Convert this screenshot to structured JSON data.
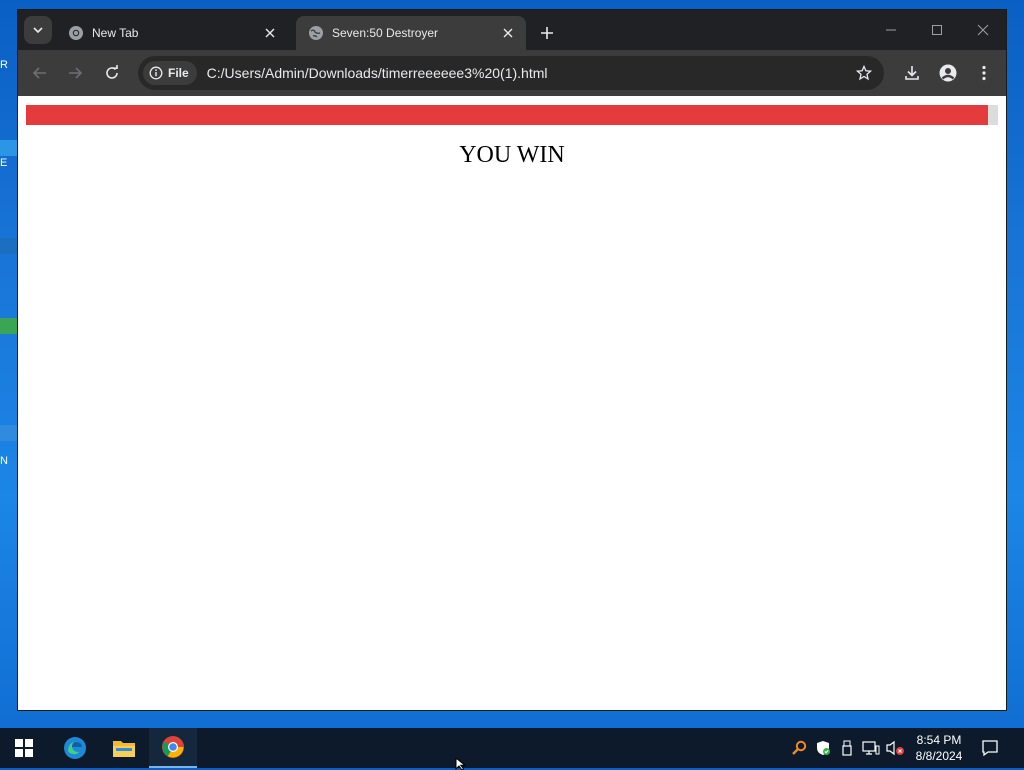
{
  "desktop": {
    "edge_glyphs": [
      "R",
      "E",
      "N"
    ]
  },
  "browser": {
    "tabs": [
      {
        "title": "New Tab",
        "active": false,
        "favicon": "chrome-icon"
      },
      {
        "title": "Seven:50 Destroyer",
        "active": true,
        "favicon": "globe-icon"
      }
    ],
    "address_bar": {
      "chip_label": "File",
      "url": "C:/Users/Admin/Downloads/timerreeeeee3%20(1).html"
    },
    "colors": {
      "tabbar_bg": "#202124",
      "toolbar_bg": "#3c3c3c",
      "omnibox_bg": "#282828"
    }
  },
  "page": {
    "progress_fraction": 0.99,
    "progress_color": "#e43c3c",
    "progress_track_color": "#dcdcdc",
    "message": "YOU WIN"
  },
  "taskbar": {
    "apps": [
      "start-icon",
      "edge-icon",
      "file-explorer-icon",
      "chrome-icon"
    ],
    "active_app": "chrome-icon",
    "tray_icons": [
      "search-tool-icon",
      "security-shield-icon",
      "usb-icon",
      "network-icon",
      "volume-muted-icon"
    ],
    "time": "8:54 PM",
    "date": "8/8/2024"
  }
}
